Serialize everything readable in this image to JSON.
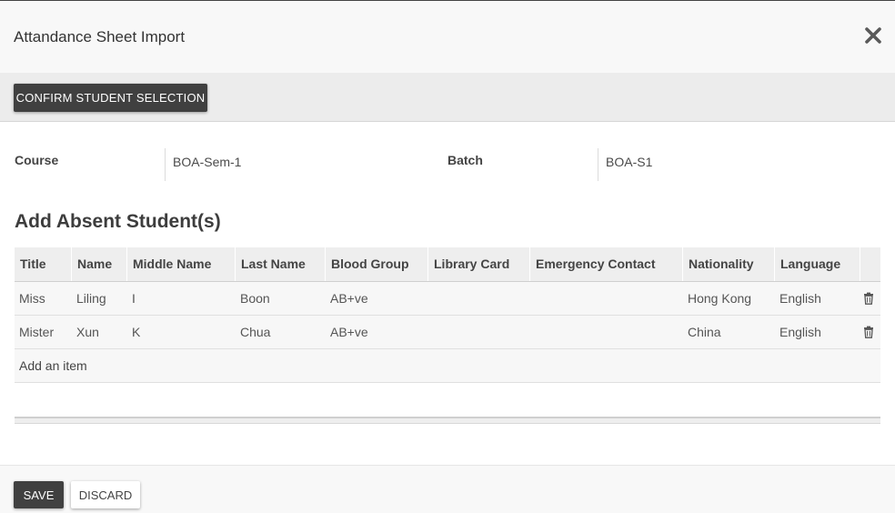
{
  "dialog": {
    "title": "Attandance Sheet Import",
    "close_icon": "close-icon"
  },
  "toolbar": {
    "confirm_label": "CONFIRM STUDENT SELECTION"
  },
  "form": {
    "course_label": "Course",
    "course_value": "BOA-Sem-1",
    "batch_label": "Batch",
    "batch_value": "BOA-S1"
  },
  "section": {
    "title": "Add Absent Student(s)"
  },
  "table": {
    "columns": [
      "Title",
      "Name",
      "Middle Name",
      "Last Name",
      "Blood Group",
      "Library Card",
      "Emergency Contact",
      "Nationality",
      "Language"
    ],
    "rows": [
      [
        "Miss",
        "Liling",
        "I",
        "Boon",
        "AB+ve",
        "",
        "",
        "Hong Kong",
        "English"
      ],
      [
        "Mister",
        "Xun",
        "K",
        "Chua",
        "AB+ve",
        "",
        "",
        "China",
        "English"
      ]
    ],
    "add_item_label": "Add an item",
    "row_action_icon": "trash-icon"
  },
  "footer": {
    "save_label": "SAVE",
    "discard_label": "DISCARD"
  },
  "colors": {
    "primary_button": "#404040",
    "header_bg": "#f8f8f8",
    "table_header_bg": "#eeeeee"
  }
}
